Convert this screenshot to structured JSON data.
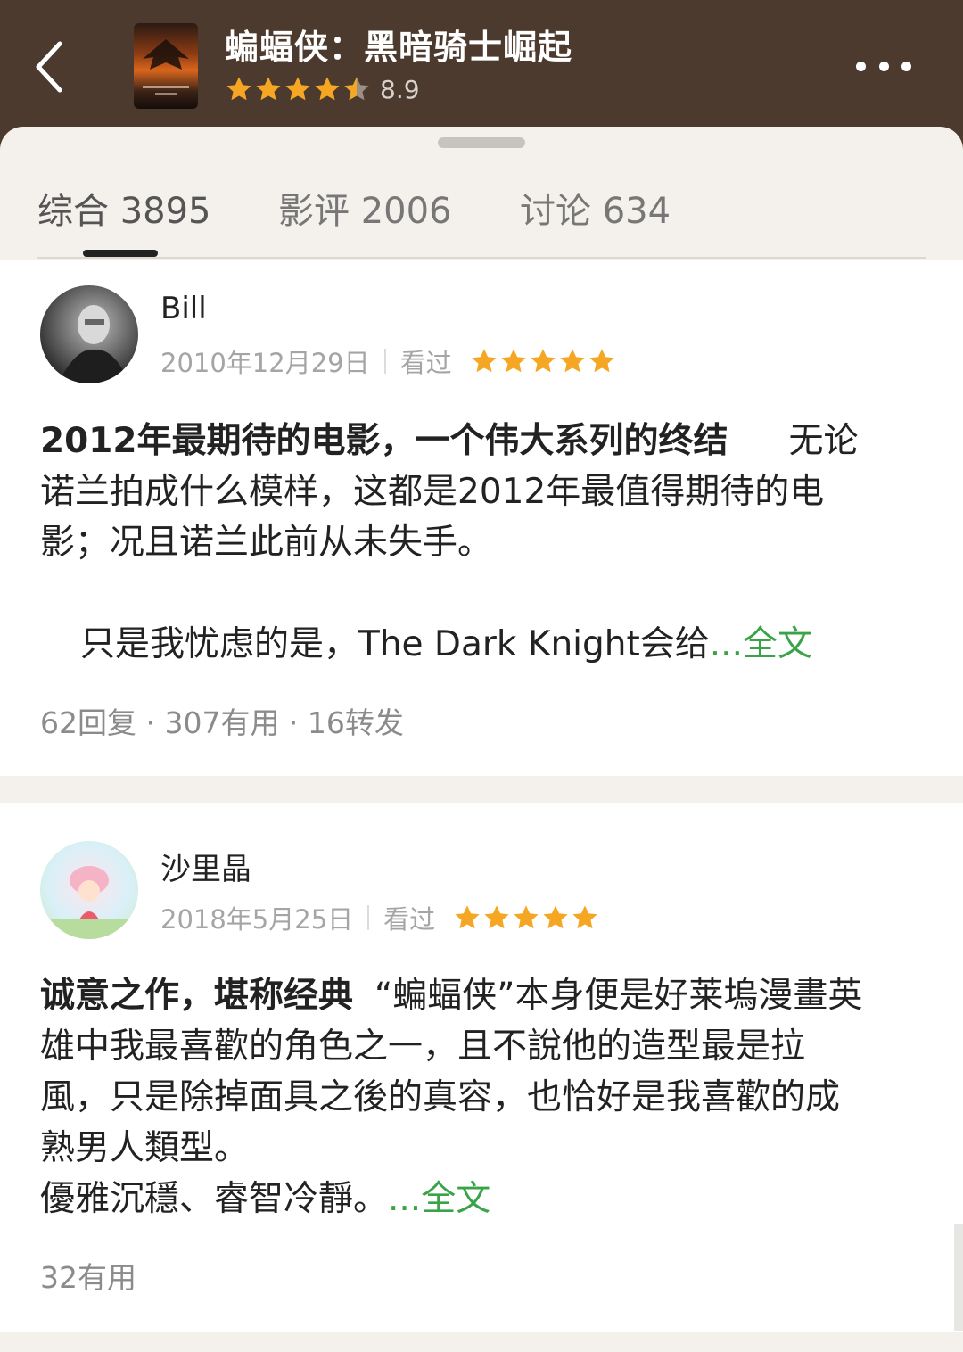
{
  "header": {
    "movie_title": "蝙蝠侠：黑暗骑士崛起",
    "rating": "8.9",
    "rating_stars": 4.5,
    "star_color": "#f5a623"
  },
  "tabs": [
    {
      "label": "综合 3895",
      "active": true
    },
    {
      "label": "影评 2006",
      "active": false
    },
    {
      "label": "讨论 634",
      "active": false
    }
  ],
  "reviews": [
    {
      "user": "Bill",
      "date": "2010年12月29日",
      "status": "看过",
      "stars": 5,
      "title": "2012年最期待的电影，一个伟大系列的终结",
      "line1_tail": "无论",
      "line2": "诺兰拍成什么模样，这都是2012年最值得期待的电",
      "line3": "影；况且诺兰此前从未失手。",
      "line4": "只是我忧虑的是，The Dark Knight会给",
      "more": "...全文",
      "stats": "62回复 · 307有用 · 16转发"
    },
    {
      "user": "沙里晶",
      "date": "2018年5月25日",
      "status": "看过",
      "stars": 5,
      "title": "诚意之作，堪称经典",
      "line1_tail": "“蝙蝠侠”本身便是好莱塢漫畫英",
      "line2": "雄中我最喜歡的角色之一，且不說他的造型最是拉",
      "line3": "風，只是除掉面具之後的真容，也恰好是我喜歡的成",
      "line4": "熟男人類型。",
      "line5": "優雅沉穩、睿智冷靜。",
      "more": "...全文",
      "stats": "32有用"
    }
  ],
  "icons": {
    "back": "chevron-left-icon",
    "more": "more-dots-icon",
    "star": "star-icon"
  },
  "colors": {
    "header_bg": "#4d3a2e",
    "link_green": "#3aa348",
    "star_gold": "#f5a623"
  }
}
